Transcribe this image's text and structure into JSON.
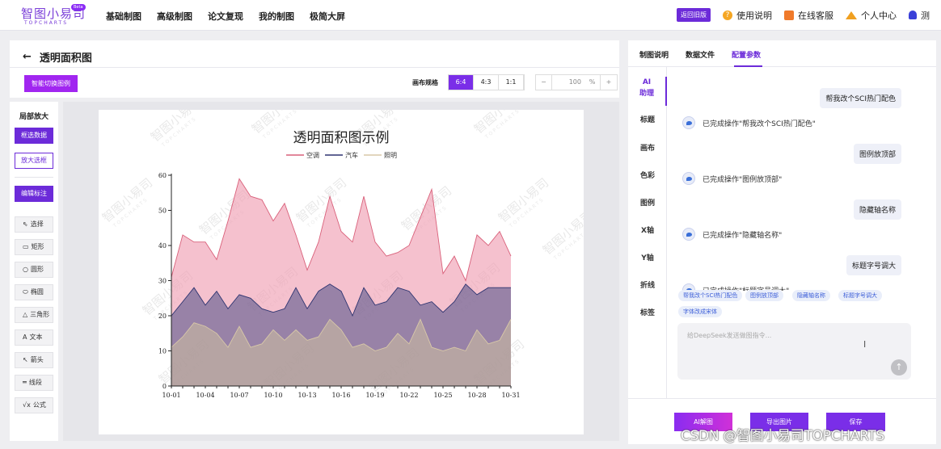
{
  "header": {
    "logo": "智图小易司",
    "logo_sub": "TOPCHARTS",
    "beta": "Beta",
    "nav": [
      "基础制图",
      "高级制图",
      "论文复现",
      "我的制图",
      "极简大屏"
    ],
    "old_version": "返回旧版",
    "help": "使用说明",
    "service": "在线客服",
    "personal": "个人中心",
    "user": "测"
  },
  "editor": {
    "title": "透明面积图",
    "smart_switch": "智能切换图例",
    "canvas_label": "画布规格",
    "ratios": [
      "6:4",
      "4:3",
      "1:1"
    ],
    "active_ratio": "6:4",
    "zoom_minus": "−",
    "zoom_value": "100",
    "zoom_unit": "%",
    "zoom_plus": "+"
  },
  "tools": {
    "header": "局部放大",
    "select_data": "框选数据",
    "zoom_select": "放大选框",
    "edit_annotation": "编辑标注",
    "items": [
      {
        "icon": "cursor-icon",
        "glyph": "⇖",
        "label": "选择"
      },
      {
        "icon": "rectangle-icon",
        "glyph": "▭",
        "label": "矩形"
      },
      {
        "icon": "circle-icon",
        "glyph": "○",
        "label": "圆形"
      },
      {
        "icon": "ellipse-icon",
        "glyph": "⬭",
        "label": "椭圆"
      },
      {
        "icon": "triangle-icon",
        "glyph": "△",
        "label": "三角形"
      },
      {
        "icon": "text-icon",
        "glyph": "A",
        "label": "文本"
      },
      {
        "icon": "arrow-icon",
        "glyph": "↖",
        "label": "箭头"
      },
      {
        "icon": "line-icon",
        "glyph": "═",
        "label": "线段"
      },
      {
        "icon": "formula-icon",
        "glyph": "√x",
        "label": "公式"
      }
    ]
  },
  "watermark": "智图小易司",
  "watermark_sub": "TOPCHARTS",
  "chart_data": {
    "type": "area",
    "title": "透明面积图示例",
    "xlabel": "",
    "ylabel": "",
    "ylim": [
      0,
      60
    ],
    "yticks": [
      0,
      10,
      20,
      30,
      40,
      50,
      60
    ],
    "grid": false,
    "legend": "top",
    "x": [
      "10-01",
      "10-02",
      "10-03",
      "10-04",
      "10-05",
      "10-06",
      "10-07",
      "10-08",
      "10-09",
      "10-10",
      "10-11",
      "10-12",
      "10-13",
      "10-14",
      "10-15",
      "10-16",
      "10-17",
      "10-18",
      "10-19",
      "10-20",
      "10-21",
      "10-22",
      "10-23",
      "10-24",
      "10-25",
      "10-26",
      "10-27",
      "10-28",
      "10-29",
      "10-30",
      "10-31"
    ],
    "xtick_labels": [
      "10-01",
      "10-04",
      "10-07",
      "10-10",
      "10-13",
      "10-16",
      "10-19",
      "10-22",
      "10-25",
      "10-28",
      "10-31"
    ],
    "series": [
      {
        "name": "空调",
        "line_color": "#d9607a",
        "fill_color": "#f0a0b4",
        "values": [
          31,
          43,
          41,
          41,
          36,
          47,
          59,
          54,
          53,
          47,
          52,
          43,
          33,
          41,
          54,
          44,
          41,
          54,
          41,
          37,
          38,
          40,
          48,
          56,
          32,
          37,
          30,
          43,
          40,
          44,
          37
        ]
      },
      {
        "name": "汽车",
        "line_color": "#2e3470",
        "fill_color": "#4a4f86",
        "values": [
          20,
          24,
          28,
          23,
          27,
          22,
          26,
          25,
          22,
          21,
          22,
          28,
          22,
          27,
          29,
          27,
          20,
          28,
          23,
          24,
          28,
          27,
          23,
          24,
          21,
          24,
          29,
          26,
          28,
          28,
          28
        ]
      },
      {
        "name": "照明",
        "line_color": "#d8c8a8",
        "fill_color": "#c9bba0",
        "values": [
          11,
          14,
          18,
          17,
          15,
          11,
          17,
          11,
          12,
          16,
          13,
          16,
          13,
          14,
          19,
          16,
          11,
          12,
          10,
          11,
          15,
          12,
          19,
          11,
          10,
          11,
          10,
          16,
          12,
          13,
          19
        ]
      }
    ]
  },
  "right": {
    "tabs": [
      "制图说明",
      "数据文件",
      "配置参数"
    ],
    "active_tab": "配置参数",
    "nav": [
      "AI\n助理",
      "标题",
      "画布",
      "色彩",
      "图例",
      "X轴",
      "Y轴",
      "折线",
      "标签"
    ],
    "messages": [
      {
        "type": "user",
        "text": "帮我改个SCI热门配色"
      },
      {
        "type": "done",
        "text": "已完成操作\"帮我改个SCI热门配色\""
      },
      {
        "type": "user",
        "text": "图例放顶部"
      },
      {
        "type": "done",
        "text": "已完成操作\"图例放顶部\""
      },
      {
        "type": "user",
        "text": "隐藏轴名称"
      },
      {
        "type": "done",
        "text": "已完成操作\"隐藏轴名称\""
      },
      {
        "type": "user",
        "text": "标题字号调大"
      },
      {
        "type": "done",
        "text": "已完成操作\"标题字号调大\""
      }
    ],
    "chips": [
      "帮我改个SCI热门配色",
      "图例放顶部",
      "隐藏轴名称",
      "标题字号调大",
      "字体改成宋体"
    ],
    "input_placeholder": "给DeepSeek发送做图指令...",
    "send": "↑",
    "buttons": [
      "AI解图",
      "导出图片",
      "保存"
    ]
  },
  "csdn_watermark": "CSDN @智图小易司TOPCHARTS"
}
